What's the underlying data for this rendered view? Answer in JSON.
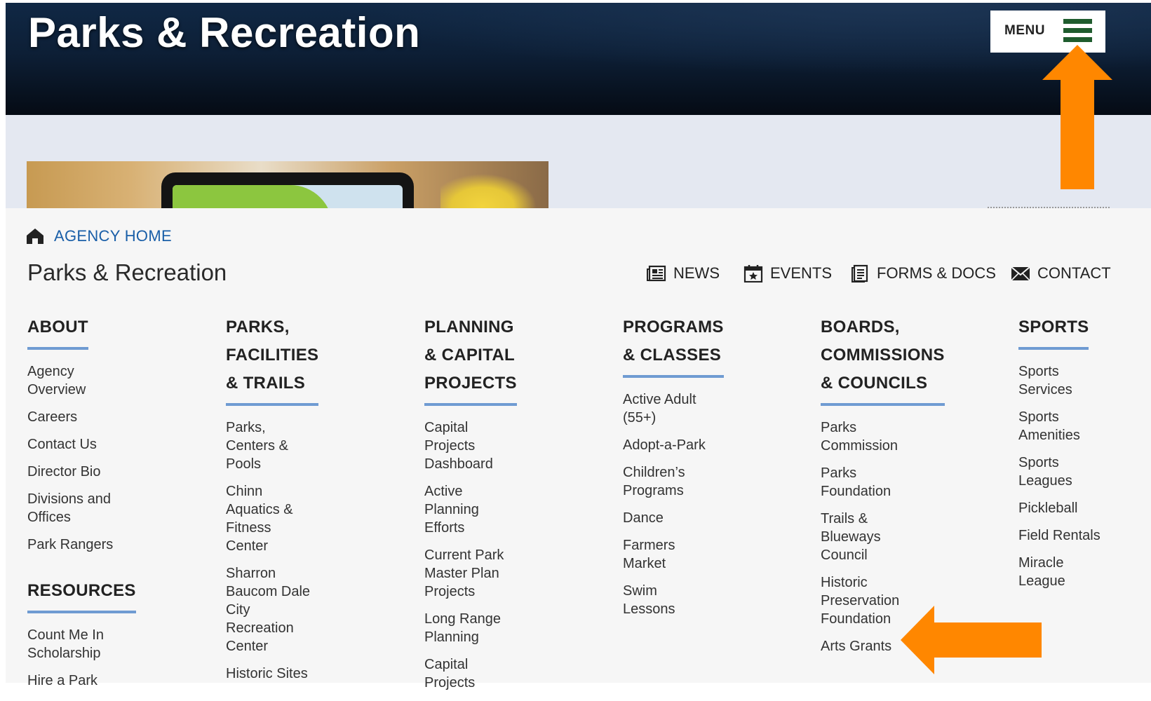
{
  "header": {
    "title": "Parks & Recreation",
    "menu_label": "MENU"
  },
  "breadcrumb": {
    "agency_home": "AGENCY HOME"
  },
  "department_title": "Parks & Recreation",
  "utility_links": [
    {
      "label": "NEWS",
      "icon": "newspaper-icon"
    },
    {
      "label": "EVENTS",
      "icon": "calendar-icon"
    },
    {
      "label": "FORMS & DOCS",
      "icon": "document-icon"
    },
    {
      "label": "CONTACT",
      "icon": "envelope-icon"
    }
  ],
  "columns": [
    {
      "heading_lines": [
        "ABOUT"
      ],
      "items": [
        "Agency Overview",
        "Careers",
        "Contact Us",
        "Director Bio",
        "Divisions and Offices",
        "Park Rangers"
      ],
      "sub_heading": "RESOURCES",
      "sub_items": [
        "Count Me In Scholarship",
        "Hire a Park"
      ]
    },
    {
      "heading_lines": [
        "PARKS,",
        "FACILITIES",
        "& TRAILS"
      ],
      "items": [
        "Parks, Centers & Pools",
        "Chinn Aquatics & Fitness Center",
        "Sharron Baucom Dale City Recreation Center",
        "Historic Sites"
      ]
    },
    {
      "heading_lines": [
        "PLANNING",
        "& CAPITAL",
        "PROJECTS"
      ],
      "items": [
        "Capital Projects Dashboard",
        "Active Planning Efforts",
        "Current Park Master Plan Projects",
        "Long Range Planning",
        "Capital Projects"
      ]
    },
    {
      "heading_lines": [
        "PROGRAMS",
        "& CLASSES"
      ],
      "items": [
        "Active Adult (55+)",
        "Adopt-a-Park",
        "Children’s Programs",
        "Dance",
        "Farmers Market",
        "Swim Lessons"
      ]
    },
    {
      "heading_lines": [
        "BOARDS,",
        "COMMISSIONS",
        "& COUNCILS"
      ],
      "items": [
        "Parks Commission",
        "Parks Foundation",
        "Trails & Blueways Council",
        "Historic Preservation Foundation",
        "Arts Grants"
      ]
    },
    {
      "heading_lines": [
        "SPORTS"
      ],
      "items": [
        "Sports Services",
        "Sports Amenities",
        "Sports Leagues",
        "Pickleball",
        "Field Rentals",
        "Miracle League"
      ]
    }
  ],
  "colors": {
    "accent_bar": "#6f9bd2",
    "link_blue": "#1a5fa8",
    "arrow_orange": "#ff8700",
    "menu_burger": "#1f5c2e"
  }
}
